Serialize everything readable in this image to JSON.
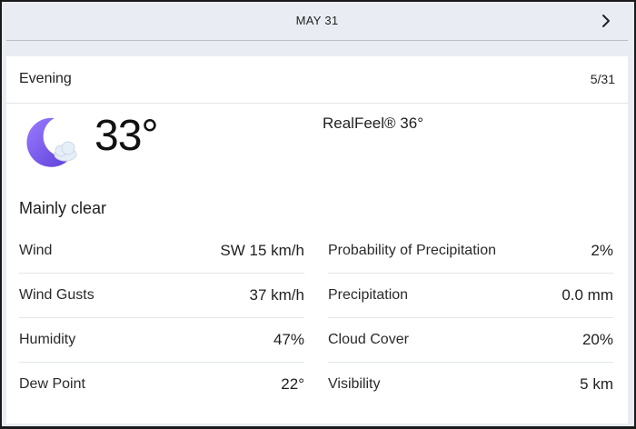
{
  "date_bar": {
    "date": "MAY 31",
    "next_icon": "chevron-right-icon"
  },
  "card": {
    "period": "Evening",
    "date": "5/31",
    "weather_icon": "moon-cloud-icon",
    "temperature": "33°",
    "realfeel_label": "RealFeel®",
    "realfeel_value": "36°",
    "condition": "Mainly clear",
    "details_left": [
      {
        "label": "Wind",
        "value": "SW 15 km/h"
      },
      {
        "label": "Wind Gusts",
        "value": "37 km/h"
      },
      {
        "label": "Humidity",
        "value": "47%"
      },
      {
        "label": "Dew Point",
        "value": "22°"
      }
    ],
    "details_right": [
      {
        "label": "Probability of Precipitation",
        "value": "2%"
      },
      {
        "label": "Precipitation",
        "value": "0.0 mm"
      },
      {
        "label": "Cloud Cover",
        "value": "20%"
      },
      {
        "label": "Visibility",
        "value": "5 km"
      }
    ]
  },
  "colors": {
    "page_background": "#e9edf3",
    "card_background": "#ffffff",
    "moon": "#7b5cf0",
    "cloud": "#e6eef8"
  }
}
